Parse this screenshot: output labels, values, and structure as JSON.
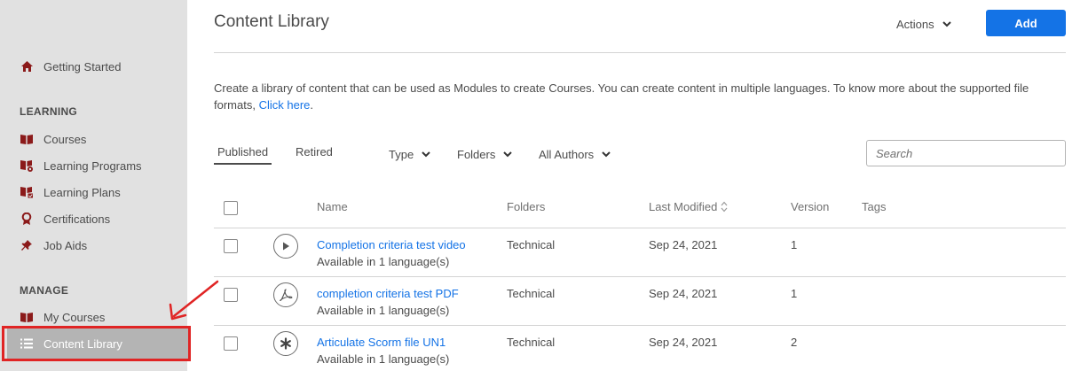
{
  "sidebar": {
    "getting_started": "Getting Started",
    "learning_section": "LEARNING",
    "learning_items": [
      "Courses",
      "Learning Programs",
      "Learning Plans",
      "Certifications",
      "Job Aids"
    ],
    "manage_section": "MANAGE",
    "manage_items": [
      "My Courses",
      "Content Library"
    ],
    "active_item": "Content Library"
  },
  "header": {
    "title": "Content Library",
    "actions_label": "Actions",
    "add_label": "Add"
  },
  "description": {
    "text": "Create a library of content that can be used as Modules to create Courses. You can create content in multiple languages. To know more about the supported file formats, ",
    "link": "Click here",
    "suffix": "."
  },
  "tabs": [
    "Published",
    "Retired"
  ],
  "filters": [
    "Type",
    "Folders",
    "All Authors"
  ],
  "search": {
    "placeholder": "Search"
  },
  "table": {
    "columns": [
      "Name",
      "Folders",
      "Last Modified",
      "Version",
      "Tags"
    ],
    "rows": [
      {
        "icon": "play-icon",
        "name": "Completion criteria test video",
        "sub": "Available in 1 language(s)",
        "folder": "Technical",
        "modified": "Sep 24, 2021",
        "version": "1",
        "tags": ""
      },
      {
        "icon": "pdf-icon",
        "name": "completion criteria test PDF",
        "sub": "Available in 1 language(s)",
        "folder": "Technical",
        "modified": "Sep 24, 2021",
        "version": "1",
        "tags": ""
      },
      {
        "icon": "scorm-asterisk-icon",
        "name": "Articulate Scorm file UN1",
        "sub": "Available in 1 language(s)",
        "folder": "Technical",
        "modified": "Sep 24, 2021",
        "version": "2",
        "tags": ""
      }
    ]
  },
  "colors": {
    "accent": "#1473e6",
    "sidebar_bg": "#e1e1e1",
    "active_bg": "#b4b4b4",
    "icon_maroon": "#8b1a1a",
    "annotation_red": "#e02424"
  }
}
